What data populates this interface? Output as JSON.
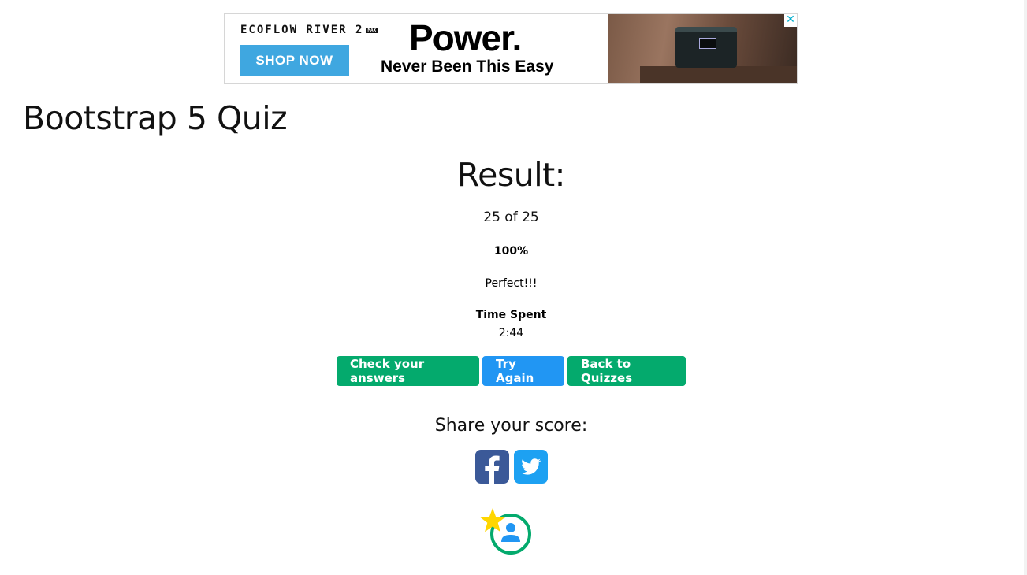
{
  "ad": {
    "brand": "ECOFLOW RIVER 2",
    "brand_badge": "MAX",
    "cta": "SHOP NOW",
    "headline": "Power.",
    "subline": "Never Been This Easy",
    "close_glyph": "✕"
  },
  "page": {
    "title": "Bootstrap 5 Quiz"
  },
  "result": {
    "title": "Result:",
    "score": "25 of 25",
    "percent": "100%",
    "message": "Perfect!!!",
    "time_label": "Time Spent",
    "time_value": "2:44"
  },
  "buttons": {
    "check": "Check your answers",
    "try_again": "Try Again",
    "back": "Back to Quizzes"
  },
  "share": {
    "title": "Share your score:",
    "icons": [
      "facebook-icon",
      "twitter-icon"
    ]
  },
  "colors": {
    "green": "#04aa6d",
    "blue": "#2196f3",
    "facebook": "#3b5998",
    "twitter": "#1da1f2",
    "star": "#ffd600"
  }
}
